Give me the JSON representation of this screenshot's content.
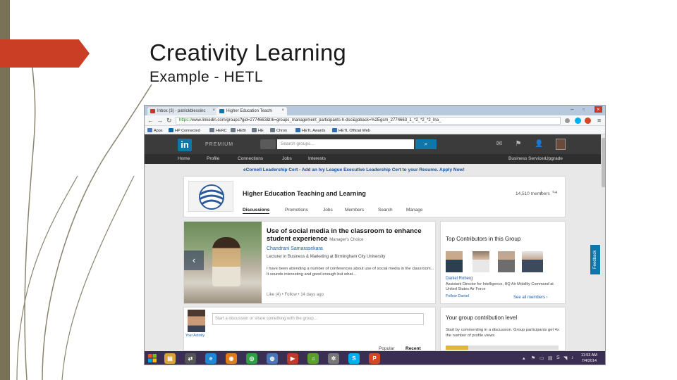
{
  "slide": {
    "title": "Creativity Learning",
    "subtitle": "Example - HETL"
  },
  "browser": {
    "tabs": [
      {
        "label": "Inbox (3) - patrickblessinc",
        "color": "#c8372c"
      },
      {
        "label": "Higher Education Teachi",
        "color": "#0e76a8"
      }
    ],
    "url_secure": "https://",
    "url": "www.linkedin.com/groups?gid=2774663&trk=groups_management_participants-h-dsc&goback=%2Egsm_2774663_1_*2_*2_*2_lna_",
    "bookmarks": [
      "Apps",
      "HP Connected",
      "HERC",
      "HEBI",
      "HE",
      "Chron",
      "HETL Awards",
      "HETL Official Web"
    ]
  },
  "linkedin": {
    "logo": "in",
    "premium": "PREMIUM",
    "search_placeholder": "Search groups...",
    "nav": [
      "Home",
      "Profile",
      "Connections",
      "Jobs",
      "Interests",
      "Business Services",
      "Upgrade"
    ],
    "promo": "eCornell Leadership Cert - Add an Ivy League Executive Leadership Cert to your Resume. Apply Now!",
    "group": {
      "name": "Higher Education Teaching and Learning",
      "members": "14,510 members",
      "tabs": [
        "Discussions",
        "Promotions",
        "Jobs",
        "Members",
        "Search",
        "Manage"
      ]
    },
    "feature": {
      "title": "Use of social media in the classroom to enhance student experience",
      "tag": "Manager's Choice",
      "author": "Chandrani Samarasekara",
      "role": "Lecturer in Business & Marketing at Birmingham City University",
      "text": "I have been attending a number of conferences about use of social media in the classroom... It sounds interesting and good enough but what...",
      "meta": "Like (4) • Follow • 14 days ago"
    },
    "contributors": {
      "title": "Top Contributors in this Group",
      "name": "Daniel Roberg",
      "desc": "Assistant Director for Intelligence, HQ Air Mobility Command at United States Air Force",
      "follow": "Follow Daniel",
      "see_all": "See all members ›"
    },
    "start": {
      "placeholder": "Start a discussion or share something with the group...",
      "activity": "Your Activity",
      "sort_popular": "Popular",
      "sort_recent": "Recent"
    },
    "level": {
      "title": "Your group contribution level",
      "text": "Start by commenting in a discussion. Group participants get 4x the number of profile views",
      "progress": 0.2
    },
    "feedback": "Feedback"
  },
  "taskbar": {
    "time": "11:53 AM",
    "date": "7/4/2014",
    "apps": [
      {
        "icon": "explorer-icon",
        "color": "#d9a53a",
        "glyph": "▤"
      },
      {
        "icon": "network-icon",
        "color": "#555555",
        "glyph": "⇄"
      },
      {
        "icon": "ie-icon",
        "color": "#1e88d6",
        "glyph": "e"
      },
      {
        "icon": "firefox-icon",
        "color": "#e07a1a",
        "glyph": "◉"
      },
      {
        "icon": "chrome-icon",
        "color": "#2f9e44",
        "glyph": "◎"
      },
      {
        "icon": "globe-icon",
        "color": "#4777b8",
        "glyph": "◍"
      },
      {
        "icon": "media-icon",
        "color": "#c0392b",
        "glyph": "▶"
      },
      {
        "icon": "music-icon",
        "color": "#5aa02c",
        "glyph": "♫"
      },
      {
        "icon": "gears-icon",
        "color": "#777777",
        "glyph": "✲"
      },
      {
        "icon": "skype-icon",
        "color": "#00aff0",
        "glyph": "S"
      },
      {
        "icon": "powerpoint-icon",
        "color": "#d24726",
        "glyph": "P"
      }
    ]
  }
}
